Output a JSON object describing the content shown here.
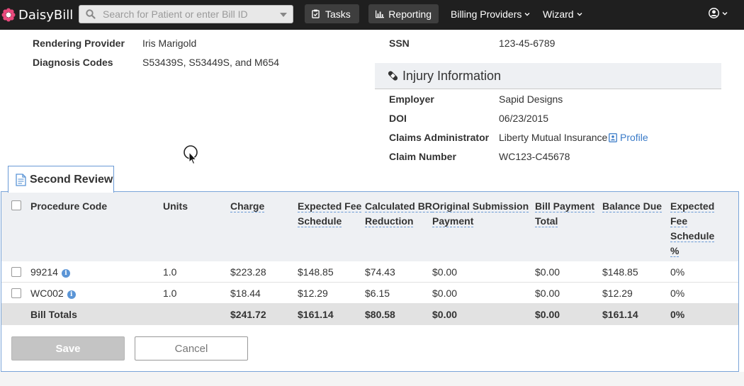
{
  "nav": {
    "brand": "DaisyBill",
    "search_placeholder": "Search for Patient or enter Bill ID",
    "tasks_label": "Tasks",
    "reporting_label": "Reporting",
    "billing_providers_label": "Billing Providers",
    "wizard_label": "Wizard"
  },
  "details": {
    "rendering_provider_label": "Rendering Provider",
    "rendering_provider_value": "Iris Marigold",
    "diagnosis_codes_label": "Diagnosis Codes",
    "diagnosis_codes_value": "S53439S, S53449S, and M654",
    "ssn_label": "SSN",
    "ssn_value": "123-45-6789"
  },
  "injury": {
    "title": "Injury Information",
    "employer_label": "Employer",
    "employer_value": "Sapid Designs",
    "doi_label": "DOI",
    "doi_value": "06/23/2015",
    "claims_admin_label": "Claims Administrator",
    "claims_admin_value": "Liberty Mutual Insurance",
    "profile_link": "Profile",
    "claim_number_label": "Claim Number",
    "claim_number_value": "WC123-C45678"
  },
  "review": {
    "tab_label": "Second Review",
    "headers": {
      "procedure_code": "Procedure Code",
      "units": "Units",
      "charge": "Charge",
      "expected_fee_1": "Expected Fee",
      "expected_fee_2": "Schedule",
      "calc_br_1": "Calculated BR",
      "calc_br_2": "Reduction",
      "orig_sub_1": "Original Submission",
      "orig_sub_2": "Payment",
      "bill_pay_1": "Bill Payment",
      "bill_pay_2": "Total",
      "balance_due": "Balance Due",
      "efs_pct_1": "Expected",
      "efs_pct_2": "Fee",
      "efs_pct_3": "Schedule",
      "efs_pct_4": "%"
    },
    "rows": [
      {
        "code": "99214",
        "units": "1.0",
        "charge": "$223.28",
        "expected_fee": "$148.85",
        "calc_br": "$74.43",
        "orig_sub": "$0.00",
        "bill_pay": "$0.00",
        "balance_due": "$148.85",
        "efs_pct": "0%"
      },
      {
        "code": "WC002",
        "units": "1.0",
        "charge": "$18.44",
        "expected_fee": "$12.29",
        "calc_br": "$6.15",
        "orig_sub": "$0.00",
        "bill_pay": "$0.00",
        "balance_due": "$12.29",
        "efs_pct": "0%"
      }
    ],
    "totals": {
      "label": "Bill Totals",
      "charge": "$241.72",
      "expected_fee": "$161.14",
      "calc_br": "$80.58",
      "orig_sub": "$0.00",
      "bill_pay": "$0.00",
      "balance_due": "$161.14",
      "efs_pct": "0%"
    },
    "save_label": "Save",
    "cancel_label": "Cancel"
  },
  "icons": {
    "brand": "daisy-flower-icon",
    "search": "search-icon",
    "tasks": "clipboard-check-icon",
    "reporting": "bar-chart-icon",
    "user": "user-circle-icon",
    "injury": "bandage-icon",
    "profile": "id-card-icon",
    "review": "document-icon",
    "info": "info-icon"
  },
  "colors": {
    "navbar": "#1f1f1f",
    "link": "#3a7bc8",
    "panel_border": "#7aa4d8",
    "header_bg": "#eef0f3",
    "totals_bg": "#e2e2e2",
    "save_disabled": "#c4c4c4"
  }
}
